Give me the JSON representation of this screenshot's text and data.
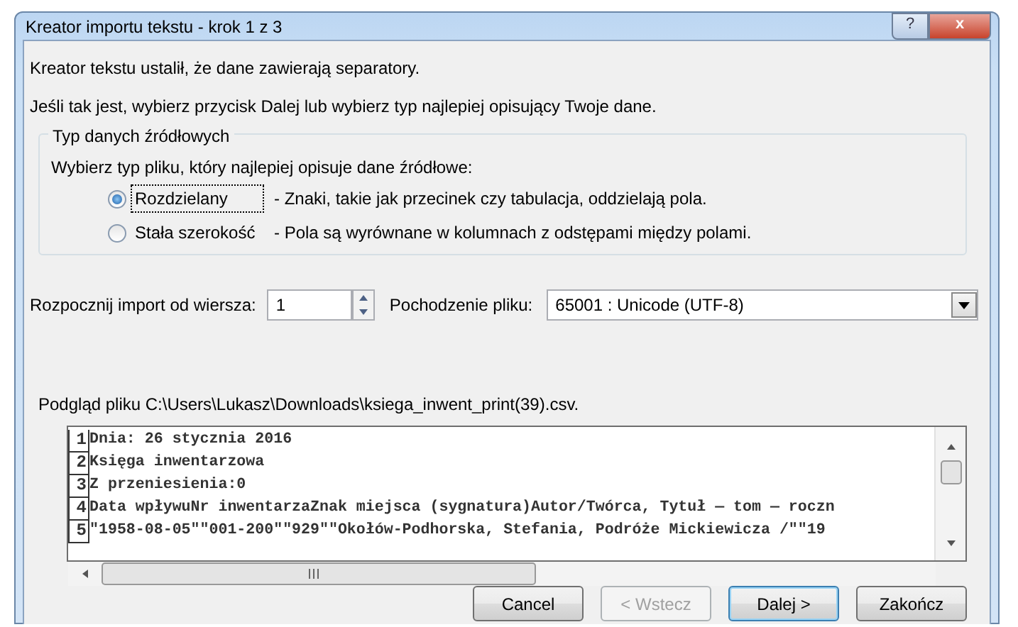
{
  "window": {
    "title": "Kreator importu tekstu - krok 1 z 3",
    "controls": [
      "?",
      "x"
    ]
  },
  "intro": [
    "Kreator tekstu ustalił, że dane zawierają separatory.",
    "Jeśli tak jest, wybierz przycisk Dalej lub wybierz typ najlepiej opisujący Twoje dane."
  ],
  "source_type": {
    "legend": "Typ danych źródłowych",
    "prompt": "Wybierz typ pliku, który najlepiej opisuje dane źródłowe:",
    "options": [
      {
        "label": "Rozdzielany",
        "description": "- Znaki, takie jak przecinek czy tabulacja, oddzielają pola.",
        "selected": true
      },
      {
        "label": "Stała szerokość",
        "description": "- Pola są wyrównane w kolumnach z odstępami między polami.",
        "selected": false
      }
    ]
  },
  "start_row": {
    "label": "Rozpocznij import od wiersza:",
    "value": "1"
  },
  "file_origin": {
    "label": "Pochodzenie pliku:",
    "value": "65001 : Unicode (UTF-8)"
  },
  "preview": {
    "label": "Podgląd pliku C:\\Users\\Lukasz\\Downloads\\ksiega_inwent_print(39).csv.",
    "rows": [
      {
        "number": "1",
        "text": "Dnia: 26 stycznia 2016"
      },
      {
        "number": "2",
        "text": "Księga inwentarzowa"
      },
      {
        "number": "3",
        "text": "Z przeniesienia:0"
      },
      {
        "number": "4",
        "text": "Data wpływuNr inwentarzaZnak miejsca (sygnatura)Autor/Twórca, Tytuł — tom — roczn"
      },
      {
        "number": "5",
        "text": "\"1958-08-05\"\"001-200\"\"929\"\"Okołów-Podhorska, Stefania, Podróże Mickiewicza /\"\"19"
      }
    ]
  },
  "buttons": [
    {
      "label": "Cancel",
      "disabled": false,
      "default": false
    },
    {
      "label": "< Wstecz",
      "disabled": true,
      "default": false
    },
    {
      "label": "Dalej >",
      "disabled": false,
      "default": true
    },
    {
      "label": "Zakończ",
      "disabled": false,
      "default": false
    }
  ]
}
